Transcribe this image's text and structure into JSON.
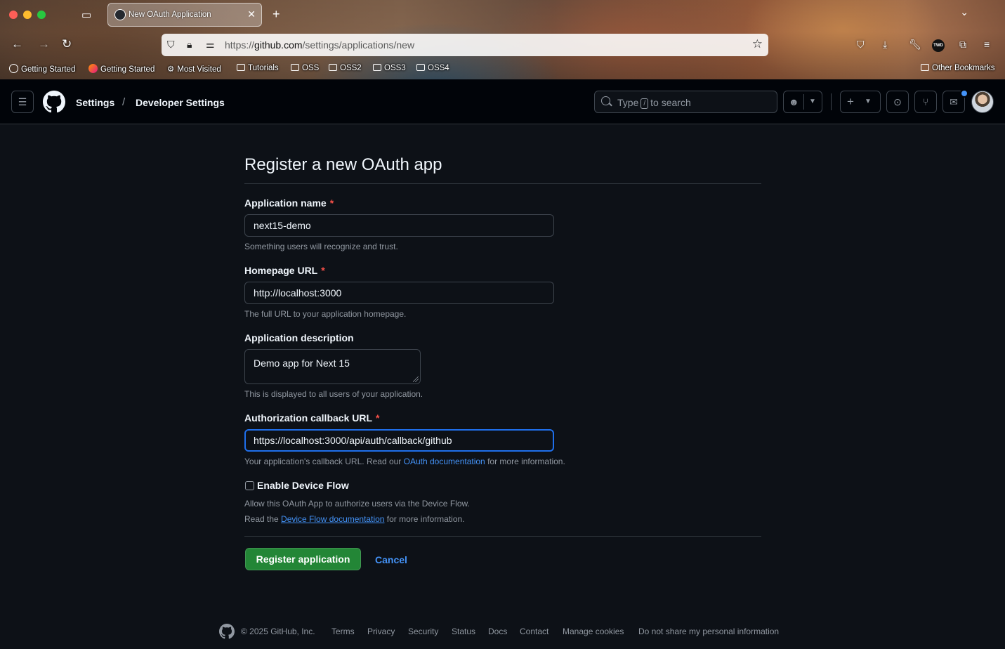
{
  "browser": {
    "tab_title": "New OAuth Application",
    "url_prefix": "https://",
    "url_host": "github.com",
    "url_path": "/settings/applications/new",
    "bookmarks": [
      {
        "label": "Getting Started",
        "icon": "globe-icon"
      },
      {
        "label": "Getting Started",
        "icon": "firefox-icon"
      },
      {
        "label": "Most Visited",
        "icon": "gear-icon"
      },
      {
        "label": "Tutorials",
        "icon": "folder-icon"
      },
      {
        "label": "OSS",
        "icon": "folder-icon"
      },
      {
        "label": "OSS2",
        "icon": "folder-icon"
      },
      {
        "label": "OSS3",
        "icon": "folder-icon"
      },
      {
        "label": "OSS4",
        "icon": "folder-icon"
      }
    ],
    "other_bookmarks": "Other Bookmarks",
    "twd_badge": "TWD"
  },
  "header": {
    "crumb_settings": "Settings",
    "crumb_separator": "/",
    "crumb_developer": "Developer Settings",
    "search_before": "Type",
    "search_key": "/",
    "search_after": "to search"
  },
  "form": {
    "title": "Register a new OAuth app",
    "app_name_label": "Application name",
    "app_name_value": "next15-demo",
    "app_name_note": "Something users will recognize and trust.",
    "homepage_label": "Homepage URL",
    "homepage_value": "http://localhost:3000",
    "homepage_note": "The full URL to your application homepage.",
    "desc_label": "Application description",
    "desc_value": "Demo app for Next 15",
    "desc_note": "This is displayed to all users of your application.",
    "callback_label": "Authorization callback URL",
    "callback_value": "https://localhost:3000/api/auth/callback/github",
    "callback_note_before": "Your application's callback URL. Read our",
    "callback_note_link": "OAuth documentation",
    "callback_note_after": "for more information.",
    "required_mark": "*",
    "device_flow_label": "Enable Device Flow",
    "device_flow_checked": false,
    "device_flow_note1": "Allow this OAuth App to authorize users via the Device Flow.",
    "device_flow_note2_before": "Read the",
    "device_flow_note2_link": "Device Flow documentation",
    "device_flow_note2_after": "for more information.",
    "register_button": "Register application",
    "cancel_button": "Cancel"
  },
  "footer": {
    "copyright": "© 2025 GitHub, Inc.",
    "links": [
      "Terms",
      "Privacy",
      "Security",
      "Status",
      "Docs",
      "Contact",
      "Manage cookies",
      "Do not share my personal information"
    ]
  },
  "colors": {
    "page_bg": "#0d1117",
    "header_bg": "#010409",
    "primary_button": "#238636",
    "link": "#4493f8",
    "required": "#f85149",
    "focus_border": "#1f6feb"
  }
}
